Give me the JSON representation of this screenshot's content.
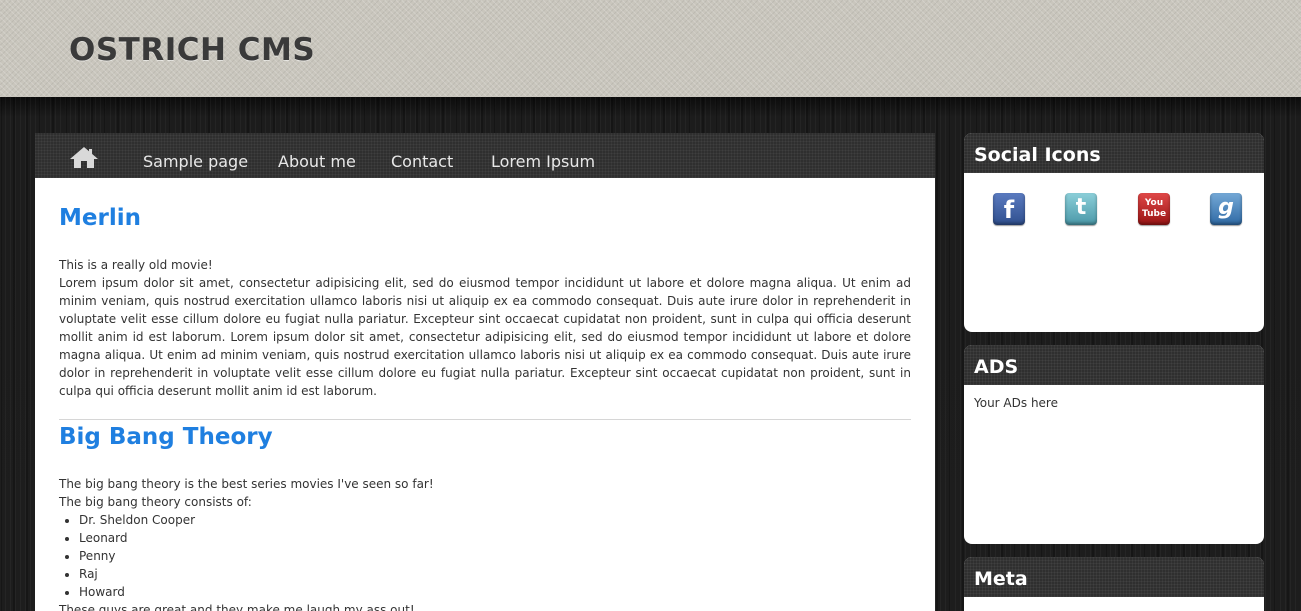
{
  "site": {
    "title": "OSTRICH CMS"
  },
  "nav": {
    "items": [
      {
        "label": "Sample page"
      },
      {
        "label": "About me"
      },
      {
        "label": "Contact"
      },
      {
        "label": "Lorem Ipsum"
      }
    ]
  },
  "posts": [
    {
      "title": "Merlin",
      "lines": [
        "This is a really old movie!",
        "Lorem ipsum dolor sit amet, consectetur adipisicing elit, sed do eiusmod tempor incididunt ut labore et dolore magna aliqua. Ut enim ad minim veniam, quis nostrud exercitation ullamco laboris nisi ut aliquip ex ea commodo consequat. Duis aute irure dolor in reprehenderit in voluptate velit esse cillum dolore eu fugiat nulla pariatur. Excepteur sint occaecat cupidatat non proident, sunt in culpa qui officia deserunt mollit anim id est laborum. Lorem ipsum dolor sit amet, consectetur adipisicing elit, sed do eiusmod tempor incididunt ut labore et dolore magna aliqua. Ut enim ad minim veniam, quis nostrud exercitation ullamco laboris nisi ut aliquip ex ea commodo consequat. Duis aute irure dolor in reprehenderit in voluptate velit esse cillum dolore eu fugiat nulla pariatur. Excepteur sint occaecat cupidatat non proident, sunt in culpa qui officia deserunt mollit anim id est laborum."
      ]
    },
    {
      "title": "Big Bang Theory",
      "intro1": "The big bang theory is the best series movies I've seen so far!",
      "intro2": "The big bang theory consists of:",
      "list": [
        "Dr. Sheldon Cooper",
        "Leonard",
        "Penny",
        "Raj",
        "Howard"
      ],
      "outro": "These guys are great and they make me laugh my ass out!"
    }
  ],
  "sidebar": {
    "social": {
      "title": "Social Icons",
      "icons": [
        {
          "name": "facebook-icon",
          "glyph": "f",
          "color": "#3b5b9a"
        },
        {
          "name": "twitter-icon",
          "glyph": "t",
          "color": "#4fa6b5"
        },
        {
          "name": "youtube-icon",
          "glyph": "You\nTube",
          "color": "#b11e1e"
        },
        {
          "name": "google-icon",
          "glyph": "g",
          "color": "#3f7fb8"
        }
      ]
    },
    "ads": {
      "title": "ADS",
      "text": "Your ADs here"
    },
    "meta": {
      "title": "Meta"
    }
  },
  "colors": {
    "link": "#1f7fe0",
    "nav_bg": "#2f2f2f",
    "header_bg": "#c9c6bd"
  }
}
